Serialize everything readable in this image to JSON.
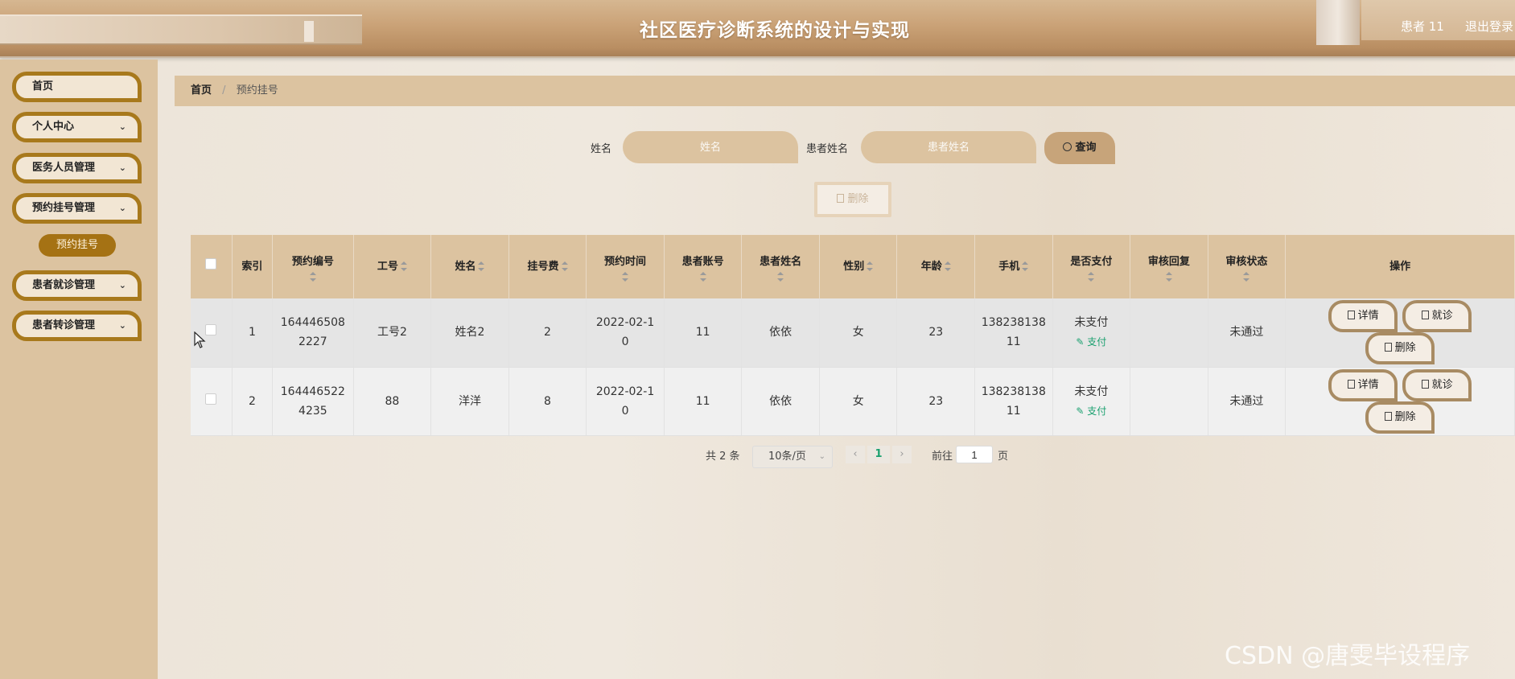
{
  "header": {
    "title": "社区医疗诊断系统的设计与实现",
    "user": "患者 11",
    "logout": "退出登录"
  },
  "sidebar": {
    "items": [
      {
        "label": "首页",
        "has_dropdown": false
      },
      {
        "label": "个人中心",
        "has_dropdown": true
      },
      {
        "label": "医务人员管理",
        "has_dropdown": true
      },
      {
        "label": "预约挂号管理",
        "has_dropdown": true
      },
      {
        "label": "患者就诊管理",
        "has_dropdown": true
      },
      {
        "label": "患者转诊管理",
        "has_dropdown": true
      }
    ],
    "active_sub": "预约挂号"
  },
  "breadcrumb": {
    "home": "首页",
    "separator": "/",
    "current": "预约挂号"
  },
  "search": {
    "name_label": "姓名",
    "name_placeholder": "姓名",
    "patient_label": "患者姓名",
    "patient_placeholder": "患者姓名",
    "query_label": "查询"
  },
  "toolbar": {
    "delete_label": "删除"
  },
  "table": {
    "columns": [
      "索引",
      "预约编号",
      "工号",
      "姓名",
      "挂号费",
      "预约时间",
      "患者账号",
      "患者姓名",
      "性别",
      "年龄",
      "手机",
      "是否支付",
      "审核回复",
      "审核状态",
      "操作"
    ],
    "rows": [
      {
        "index": "1",
        "booking_no": [
          "164446508",
          "2227"
        ],
        "staff_no": "工号2",
        "name": "姓名2",
        "fee": "2",
        "time": [
          "2022-02-1",
          "0"
        ],
        "account": "11",
        "patient_name": "依依",
        "gender": "女",
        "age": "23",
        "phone": [
          "138238138",
          "11"
        ],
        "paid": "未支付",
        "pay_action": "支付",
        "reply": "",
        "status": "未通过"
      },
      {
        "index": "2",
        "booking_no": [
          "164446522",
          "4235"
        ],
        "staff_no": "88",
        "name": "洋洋",
        "fee": "8",
        "time": [
          "2022-02-1",
          "0"
        ],
        "account": "11",
        "patient_name": "依依",
        "gender": "女",
        "age": "23",
        "phone": [
          "138238138",
          "11"
        ],
        "paid": "未支付",
        "pay_action": "支付",
        "reply": "",
        "status": "未通过"
      }
    ],
    "actions": {
      "detail": "详情",
      "visit": "就诊",
      "delete": "删除"
    }
  },
  "pagination": {
    "total": "共 2 条",
    "page_size": "10条/页",
    "current_page": "1",
    "goto_label": "前往",
    "goto_value": "1",
    "page_unit": "页"
  },
  "watermark": "CSDN @唐雯毕设程序",
  "colors": {
    "accent_gold": "#a57214",
    "sidebar_bg": "#dcc3a0",
    "pay_green": "#1aa06f"
  }
}
